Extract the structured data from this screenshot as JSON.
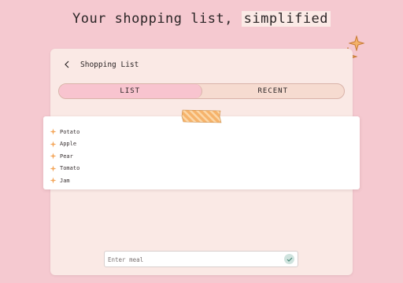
{
  "headline": {
    "text_before": "Your shopping list, ",
    "highlight": "simplified"
  },
  "window": {
    "title": "Shopping List"
  },
  "tabs": [
    {
      "label": "LIST",
      "active": true
    },
    {
      "label": "RECENT",
      "active": false
    }
  ],
  "list": {
    "items": [
      "Potato",
      "Apple",
      "Pear",
      "Tomato",
      "Jam"
    ]
  },
  "input": {
    "placeholder": "Enter meal",
    "value": ""
  },
  "icons": {
    "back": "chevron-left-icon",
    "bullet": "sparkle-icon",
    "submit": "check-icon",
    "decor": "sparkle-icon"
  },
  "colors": {
    "background": "#f5c9d0",
    "window": "#fae9e5",
    "tab_active": "#f8c4cf",
    "tab_inactive": "#f6dbd0",
    "accent_orange": "#f0a458",
    "submit": "#cfe3de"
  }
}
